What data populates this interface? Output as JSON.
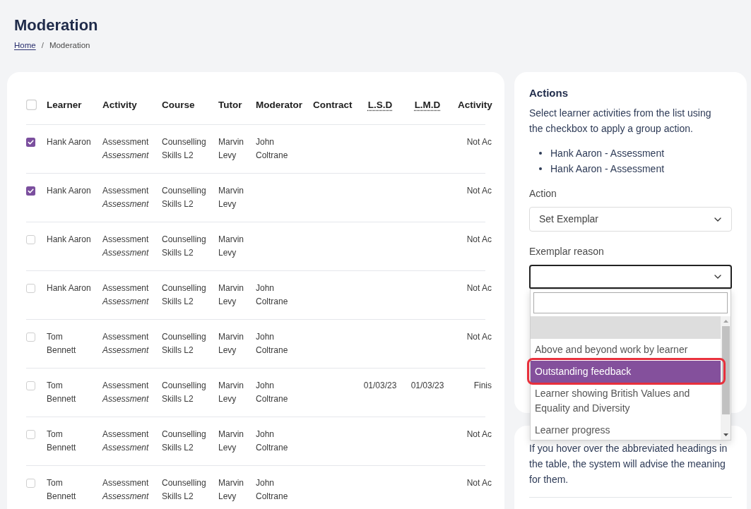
{
  "page": {
    "title": "Moderation",
    "breadcrumb": [
      {
        "label": "Home",
        "link": true
      },
      {
        "label": "Moderation",
        "link": false
      }
    ],
    "breadcrumb_separator": "/"
  },
  "table": {
    "select_all": {
      "checked": false
    },
    "columns": [
      {
        "label": "Learner",
        "abbreviated": false
      },
      {
        "label": "Activity",
        "abbreviated": false
      },
      {
        "label": "Course",
        "abbreviated": false
      },
      {
        "label": "Tutor",
        "abbreviated": false
      },
      {
        "label": "Moderator",
        "abbreviated": false
      },
      {
        "label": "Contract",
        "abbreviated": false
      },
      {
        "label": "L.S.D",
        "abbreviated": true
      },
      {
        "label": "L.M.D",
        "abbreviated": true
      },
      {
        "label": "Activity",
        "abbreviated": false
      }
    ],
    "rows": [
      {
        "checked": true,
        "learner": "Hank Aaron",
        "activity": "Assessment",
        "activity_type": "Assessment",
        "course": "Counselling Skills L2",
        "tutor": "Marvin Levy",
        "moderator": "John Coltrane",
        "column_10": "Not Ac"
      },
      {
        "checked": true,
        "learner": "Hank Aaron",
        "activity": "Assessment",
        "activity_type": "Assessment",
        "course": "Counselling Skills L2",
        "tutor": "Marvin Levy",
        "column_10": "Not Ac"
      },
      {
        "checked": false,
        "learner": "Hank Aaron",
        "activity": "Assessment",
        "activity_type": "Assessment",
        "course": "Counselling Skills L2",
        "tutor": "Marvin Levy",
        "column_10": "Not Ac"
      },
      {
        "checked": false,
        "learner": "Hank Aaron",
        "activity": "Assessment",
        "activity_type": "Assessment",
        "course": "Counselling Skills L2",
        "tutor": "Marvin Levy",
        "moderator": "John Coltrane",
        "column_10": "Not Ac"
      },
      {
        "checked": false,
        "learner": "Tom Bennett",
        "activity": "Assessment",
        "activity_type": "Assessment",
        "course": "Counselling Skills L2",
        "tutor": "Marvin Levy",
        "moderator": "John Coltrane",
        "column_10": "Not Ac"
      },
      {
        "checked": false,
        "learner": "Tom Bennett",
        "activity": "Assessment",
        "activity_type": "Assessment",
        "course": "Counselling Skills L2",
        "tutor": "Marvin Levy",
        "moderator": "John Coltrane",
        "lsd": "01/03/23",
        "lmd": "01/03/23",
        "column_10": "Finis"
      },
      {
        "checked": false,
        "learner": "Tom Bennett",
        "activity": "Assessment",
        "activity_type": "Assessment",
        "course": "Counselling Skills L2",
        "tutor": "Marvin Levy",
        "moderator": "John Coltrane",
        "column_10": "Not Ac"
      },
      {
        "checked": false,
        "learner": "Tom Bennett",
        "activity": "Assessment",
        "activity_type": "Assessment",
        "course": "Counselling Skills L2",
        "tutor": "Marvin Levy",
        "moderator": "John Coltrane",
        "column_10": "Not Ac"
      }
    ]
  },
  "actions_panel": {
    "title": "Actions",
    "description": "Select learner activities from the list using the checkbox to apply a group action.",
    "selected_items": [
      "Hank Aaron - Assessment",
      "Hank Aaron - Assessment"
    ],
    "action_field": {
      "label": "Action",
      "value": "Set Exemplar",
      "expanded": false
    },
    "reason_field": {
      "label": "Exemplar reason",
      "expanded": true,
      "options": [
        {
          "kind": "blank",
          "selected": true,
          "highlighted": false,
          "outlined": false
        },
        {
          "kind": "option",
          "label": "Above and beyond work by learner",
          "selected": false,
          "highlighted": false,
          "outlined": false
        },
        {
          "kind": "option",
          "label": "Outstanding feedback",
          "selected": false,
          "highlighted": true,
          "outlined": true
        },
        {
          "kind": "option",
          "label": "Learner showing British Values and Equality and Diversity",
          "selected": false,
          "highlighted": false,
          "outlined": false
        },
        {
          "kind": "option",
          "label": "Learner progress",
          "selected": false,
          "highlighted": false,
          "outlined": false
        }
      ]
    }
  },
  "help_panel": {
    "text": "If you hover over the abbreviated headings in the table, the system will advise the meaning for them."
  }
}
